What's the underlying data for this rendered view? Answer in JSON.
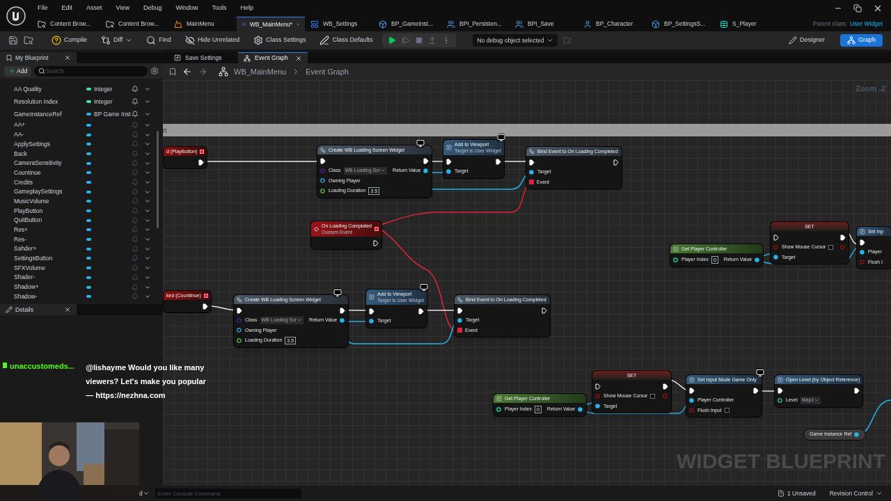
{
  "menu": [
    "File",
    "Edit",
    "Asset",
    "View",
    "Debug",
    "Window",
    "Tools",
    "Help"
  ],
  "doc_tabs": [
    {
      "label": "Content Brow...",
      "kind": "browser",
      "selected": false
    },
    {
      "label": "Content Brow...",
      "kind": "browser",
      "selected": false
    },
    {
      "label": "MainMenu",
      "kind": "level",
      "selected": false
    },
    {
      "label": "WB_MainMenu*",
      "kind": "widget",
      "selected": true
    },
    {
      "label": "WB_Settings",
      "kind": "widget",
      "selected": false
    },
    {
      "label": "BP_GameInst...",
      "kind": "instance",
      "selected": false
    },
    {
      "label": "BPI_Persisten...",
      "kind": "interface",
      "selected": false
    },
    {
      "label": "BPI_Save",
      "kind": "interface",
      "selected": false
    },
    {
      "label": "BP_Character",
      "kind": "character",
      "selected": false
    },
    {
      "label": "BP_SettingsS...",
      "kind": "instance",
      "selected": false
    },
    {
      "label": "S_Player",
      "kind": "struct",
      "selected": false
    }
  ],
  "parent_class": {
    "label": "Parent class:",
    "value": "User Widget"
  },
  "toolbar": [
    {
      "label": "Compile",
      "kind": "compile"
    },
    {
      "label": "Diff",
      "kind": "diff"
    },
    {
      "label": "Find",
      "kind": "find"
    },
    {
      "label": "Hide Unrelated",
      "kind": "hide"
    },
    {
      "label": "Class Settings",
      "kind": "settings"
    },
    {
      "label": "Class Defaults",
      "kind": "defaults"
    }
  ],
  "debug_dropdown": "No debug object selected",
  "modes": [
    {
      "label": "Designer",
      "selected": false
    },
    {
      "label": "Graph",
      "selected": true
    }
  ],
  "my_blueprint": {
    "title": "My Blueprint",
    "add": "Add",
    "search_placeholder": "Search",
    "variables": [
      {
        "name": "AA Quality",
        "type": "Integer",
        "color": "#3ee8a0"
      },
      {
        "name": "Resolution Index",
        "type": "Integer",
        "color": "#3ee8a0"
      },
      {
        "name": "GameInstanceRef",
        "type": "BP Game Inst",
        "color": "#27b4e8"
      },
      {
        "name": "AA+",
        "color": "#27b4e8"
      },
      {
        "name": "AA-",
        "color": "#27b4e8"
      },
      {
        "name": "ApplySettings",
        "color": "#27b4e8"
      },
      {
        "name": "Back",
        "color": "#27b4e8"
      },
      {
        "name": "CameraSensitivity",
        "color": "#27b4e8"
      },
      {
        "name": "Countinue",
        "color": "#27b4e8"
      },
      {
        "name": "Credits",
        "color": "#27b4e8"
      },
      {
        "name": "GameplaySettings",
        "color": "#27b4e8"
      },
      {
        "name": "MusicVolume",
        "color": "#27b4e8"
      },
      {
        "name": "PlayButton",
        "color": "#27b4e8"
      },
      {
        "name": "QuitButton",
        "color": "#27b4e8"
      },
      {
        "name": "Res+",
        "color": "#27b4e8"
      },
      {
        "name": "Res-",
        "color": "#27b4e8"
      },
      {
        "name": "Sahder+",
        "color": "#27b4e8"
      },
      {
        "name": "SettingsButton",
        "color": "#27b4e8"
      },
      {
        "name": "SFXVolume",
        "color": "#27b4e8"
      },
      {
        "name": "Shader-",
        "color": "#27b4e8"
      },
      {
        "name": "Shadow+",
        "color": "#27b4e8"
      },
      {
        "name": "Shadow-",
        "color": "#27b4e8"
      }
    ]
  },
  "details": {
    "title": "Details"
  },
  "graph_tabs": [
    {
      "label": "Save Settings",
      "kind": "function",
      "selected": false
    },
    {
      "label": "Event Graph",
      "kind": "graph",
      "selected": true
    }
  ],
  "breadcrumb": [
    "WB_MainMenu",
    "Event Graph"
  ],
  "zoom": "Zoom -2",
  "comment": "n",
  "nodes": [
    {
      "kind": "event",
      "title": "d (PlayButton)",
      "badge": false,
      "rows": [
        {
          "out": {
            "kind": "exec",
            "linked": true
          }
        }
      ]
    },
    {
      "kind": "call",
      "title": "Create WB Loading Screen Widget",
      "badge": true,
      "rows": [
        {
          "in": {
            "kind": "exec",
            "linked": true
          },
          "out": {
            "kind": "exec",
            "linked": true
          }
        },
        {
          "in": {
            "label": "Class",
            "kind": "class",
            "linked": false,
            "dropdown": "WB Loading Scr"
          },
          "out": {
            "label": "Return Value",
            "kind": "object",
            "linked": true
          }
        },
        {
          "in": {
            "label": "Owning Player",
            "kind": "object",
            "linked": false
          }
        },
        {
          "in": {
            "label": "Loading Duration",
            "kind": "float",
            "linked": false,
            "value": "3.5"
          }
        }
      ]
    },
    {
      "kind": "function",
      "title": "Add to Viewport",
      "subtitle": "Target is User Widget",
      "badge": true,
      "rows": [
        {
          "in": {
            "kind": "exec",
            "linked": true
          },
          "out": {
            "kind": "exec",
            "linked": true
          }
        },
        {
          "in": {
            "label": "Target",
            "kind": "object",
            "linked": true
          }
        }
      ]
    },
    {
      "kind": "call",
      "title": "Bind Event to On Loading Completed",
      "badge": false,
      "rows": [
        {
          "in": {
            "kind": "exec",
            "linked": true
          },
          "out": {
            "kind": "exec",
            "linked": false
          }
        },
        {
          "in": {
            "label": "Target",
            "kind": "object",
            "linked": true
          }
        },
        {
          "in": {
            "label": "Event",
            "kind": "delegate",
            "linked": true
          }
        }
      ]
    },
    {
      "kind": "custom_event",
      "title": "On Loading Complated",
      "subtitle": "Custom Event",
      "badge": false,
      "rows": [
        {
          "out": {
            "kind": "exec",
            "linked": false
          }
        }
      ]
    },
    {
      "kind": "event",
      "title": "ked (Countinue)",
      "badge": false,
      "rows": [
        {
          "out": {
            "kind": "exec",
            "linked": true
          }
        }
      ]
    },
    {
      "kind": "call",
      "title": "Create WB Loading Screen Widget",
      "badge": true,
      "rows": [
        {
          "in": {
            "kind": "exec",
            "linked": true
          },
          "out": {
            "kind": "exec",
            "linked": true
          }
        },
        {
          "in": {
            "label": "Class",
            "kind": "class",
            "linked": false,
            "dropdown": "WB Loading Scr"
          },
          "out": {
            "label": "Return Value",
            "kind": "object",
            "linked": true
          }
        },
        {
          "in": {
            "label": "Owning Player",
            "kind": "object",
            "linked": false
          }
        },
        {
          "in": {
            "label": "Loading Duration",
            "kind": "float",
            "linked": false,
            "value": "3.5"
          }
        }
      ]
    },
    {
      "kind": "function",
      "title": "Add to Viewport",
      "subtitle": "Target is User Widget",
      "badge": true,
      "rows": [
        {
          "in": {
            "kind": "exec",
            "linked": true
          },
          "out": {
            "kind": "exec",
            "linked": true
          }
        },
        {
          "in": {
            "label": "Target",
            "kind": "object",
            "linked": true
          }
        }
      ]
    },
    {
      "kind": "call",
      "title": "Bind Event to On Loading Completed",
      "badge": false,
      "rows": [
        {
          "in": {
            "kind": "exec",
            "linked": true
          },
          "out": {
            "kind": "exec",
            "linked": false
          }
        },
        {
          "in": {
            "label": "Target",
            "kind": "object",
            "linked": true
          }
        },
        {
          "in": {
            "label": "Event",
            "kind": "delegate",
            "linked": true
          }
        }
      ]
    },
    {
      "kind": "pure",
      "title": "Get Player Controller",
      "badge": false,
      "rows": [
        {
          "in": {
            "label": "Player Index",
            "kind": "int",
            "linked": false,
            "value": "0"
          },
          "out": {
            "label": "Return Value",
            "kind": "object",
            "linked": true
          }
        }
      ]
    },
    {
      "kind": "set",
      "title": "SET",
      "badge": false,
      "rows": [
        {
          "in": {
            "kind": "exec",
            "linked": false
          },
          "out": {
            "kind": "exec",
            "linked": true
          }
        },
        {
          "in": {
            "label": "Show Mouse Cursor",
            "kind": "bool",
            "linked": false,
            "checked": false
          },
          "out": {
            "kind": "bool",
            "linked": false
          }
        },
        {
          "in": {
            "label": "Target",
            "kind": "object",
            "linked": true
          }
        }
      ]
    },
    {
      "kind": "function",
      "title": "Set Inp",
      "badge": false,
      "rows": [
        {
          "in": {
            "kind": "exec",
            "linked": true
          }
        },
        {
          "in": {
            "label": "Player",
            "kind": "object",
            "linked": true
          }
        },
        {
          "in": {
            "label": "Flush I",
            "kind": "bool",
            "linked": false
          }
        }
      ]
    },
    {
      "kind": "pure",
      "title": "Get Player Controller",
      "badge": false,
      "rows": [
        {
          "in": {
            "label": "Player Index",
            "kind": "int",
            "linked": false,
            "value": "0"
          },
          "out": {
            "label": "Return Value",
            "kind": "object",
            "linked": true
          }
        }
      ]
    },
    {
      "kind": "set",
      "title": "SET",
      "badge": false,
      "rows": [
        {
          "in": {
            "kind": "exec",
            "linked": false
          },
          "out": {
            "kind": "exec",
            "linked": true
          }
        },
        {
          "in": {
            "label": "Show Mouse Cursor",
            "kind": "bool",
            "linked": false,
            "checked": false
          },
          "out": {
            "kind": "bool",
            "linked": false
          }
        },
        {
          "in": {
            "label": "Target",
            "kind": "object",
            "linked": true
          }
        }
      ]
    },
    {
      "kind": "function",
      "title": "Set Input Mode Game Only",
      "badge": true,
      "rows": [
        {
          "in": {
            "kind": "exec",
            "linked": true
          },
          "out": {
            "kind": "exec",
            "linked": true
          }
        },
        {
          "in": {
            "label": "Player Controller",
            "kind": "object",
            "linked": true
          }
        },
        {
          "in": {
            "label": "Flush Input",
            "kind": "bool",
            "linked": false,
            "checked": false
          }
        }
      ]
    },
    {
      "kind": "function",
      "title": "Open Level (by Object Reference)",
      "badge": false,
      "rows": [
        {
          "in": {
            "kind": "exec",
            "linked": true
          },
          "out": {
            "kind": "exec",
            "linked": true
          }
        },
        {
          "in": {
            "label": "Level",
            "kind": "level",
            "linked": false,
            "dropdown": "Map1"
          }
        }
      ]
    },
    {
      "kind": "variable",
      "title": "Game Instance Ref",
      "rows": [
        {
          "out": {
            "kind": "object",
            "linked": true
          }
        }
      ]
    }
  ],
  "watermark": "WIDGET BLUEPRINT",
  "chat": {
    "user": "unaccustomeds...",
    "message": "@lishayme Would you like many viewers? Let's make you popular — https://nezhna.com"
  },
  "status_bar": {
    "drawer": "d",
    "console_placeholder": "Enter Console Command",
    "unsaved": "1 Unsaved",
    "revision": "Revision Control"
  }
}
